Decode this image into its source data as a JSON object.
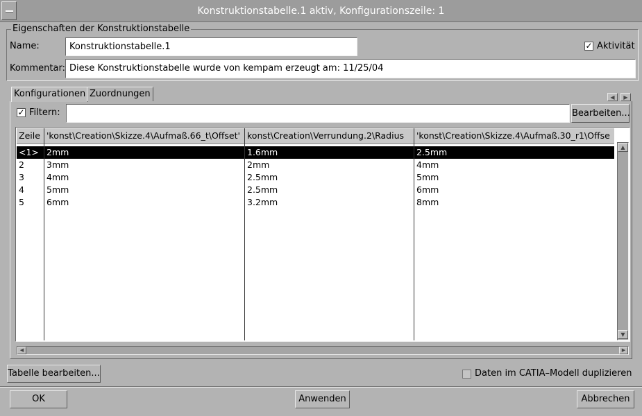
{
  "window": {
    "title": "Konstruktionstabelle.1 aktiv, Konfigurationszeile: 1"
  },
  "props": {
    "group_label": "Eigenschaften der Konstruktionstabelle",
    "name_label": "Name:",
    "name_value": "Konstruktionstabelle.1",
    "active_label": "Aktivität",
    "active_checked": true,
    "comment_label": "Kommentar:",
    "comment_value": "Diese Konstruktionstabelle wurde von kempam erzeugt am: 11/25/04"
  },
  "tabs": [
    {
      "label": "Konfigurationen",
      "active": true
    },
    {
      "label": "Zuordnungen",
      "active": false
    }
  ],
  "filter": {
    "checkbox_label": "Filtern:",
    "checked": true,
    "value": "",
    "edit_button": "Bearbeiten..."
  },
  "table": {
    "columns": [
      "Zeile",
      "'konst\\Creation\\Skizze.4\\Aufmaß.66_t\\Offset'",
      "konst\\Creation\\Verrundung.2\\Radius",
      "'konst\\Creation\\Skizze.4\\Aufmaß.30_r1\\Offse"
    ],
    "rows": [
      [
        "<1>",
        "2mm",
        "1.6mm",
        "2.5mm"
      ],
      [
        "2",
        "3mm",
        "2mm",
        "4mm"
      ],
      [
        "3",
        "4mm",
        "2.5mm",
        "5mm"
      ],
      [
        "4",
        "5mm",
        "2.5mm",
        "6mm"
      ],
      [
        "5",
        "6mm",
        "3.2mm",
        "8mm"
      ]
    ],
    "selected_row": 0
  },
  "bottom": {
    "edit_table_button": "Tabelle bearbeiten...",
    "duplicate_label": "Daten im CATIA–Modell duplizieren",
    "duplicate_checked": false
  },
  "footer": {
    "ok": "OK",
    "apply": "Anwenden",
    "cancel": "Abbrechen"
  }
}
